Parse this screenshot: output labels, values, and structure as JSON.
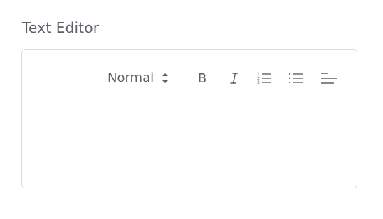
{
  "field": {
    "label": "Text Editor"
  },
  "toolbar": {
    "format_select_value": "Normal",
    "bold_label": "B",
    "icons": {
      "format_select": "updown-arrows-icon",
      "italic": "italic-icon",
      "ordered_list": "ordered-list-icon",
      "bullet_list": "bullet-list-icon",
      "align": "align-left-icon"
    }
  },
  "colors": {
    "border": "#d9dbe0",
    "text": "#5d6068",
    "background": "#ffffff"
  }
}
